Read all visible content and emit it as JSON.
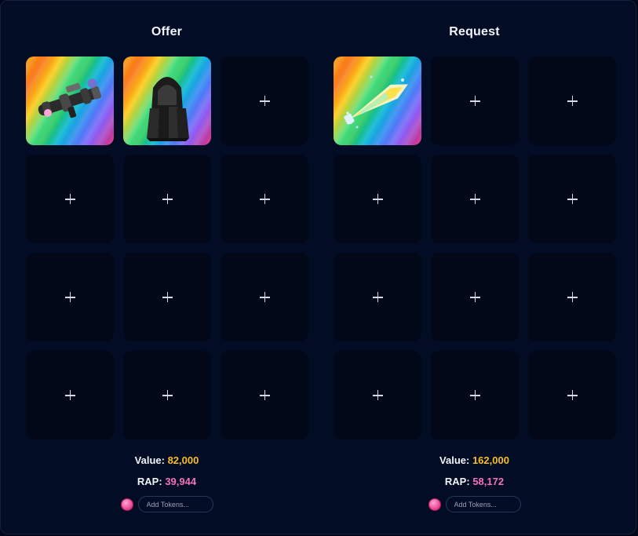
{
  "offer": {
    "title": "Offer",
    "value_label": "Value:",
    "value": "82,000",
    "rap_label": "RAP:",
    "rap": "39,944",
    "tokens_placeholder": "Add Tokens..."
  },
  "request": {
    "title": "Request",
    "value_label": "Value:",
    "value": "162,000",
    "rap_label": "RAP:",
    "rap": "58,172",
    "tokens_placeholder": "Add Tokens..."
  },
  "icons": {
    "empty_slot": "plus-icon",
    "offer_item_1": "rocket-launcher-item",
    "offer_item_2": "dark-hood-item",
    "request_item_1": "crystal-sword-item",
    "token": "token-coin-icon"
  },
  "colors": {
    "background": "#000718",
    "panel": "#020c24",
    "slot": "#020817",
    "value_gold": "#fbbf24",
    "rap_pink": "#f472b6"
  }
}
